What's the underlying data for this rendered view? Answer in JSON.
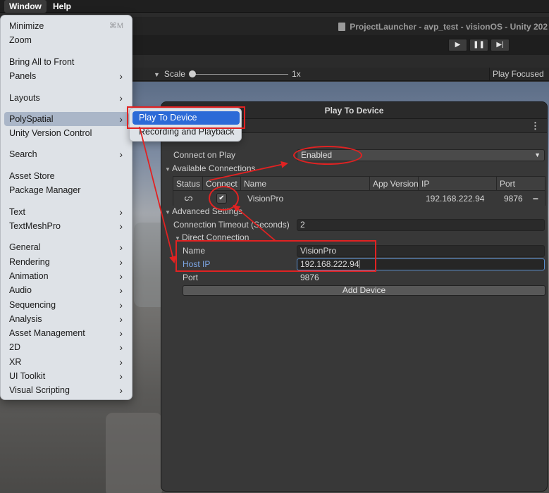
{
  "menubar": {
    "window_label": "Window",
    "help_label": "Help"
  },
  "unity": {
    "window_title": "ProjectLauncher - avp_test - visionOS - Unity 202",
    "scale_label": "Scale",
    "scale_value": "1x",
    "play_focused_label": "Play Focused"
  },
  "window_menu": {
    "items": [
      {
        "label": "Minimize",
        "shortcut": "⌘M"
      },
      {
        "label": "Zoom"
      },
      {
        "label": "Bring All to Front"
      },
      {
        "label": "Panels"
      },
      {
        "label": "Layouts"
      },
      {
        "label": "PolySpatial"
      },
      {
        "label": "Unity Version Control"
      },
      {
        "label": "Search"
      },
      {
        "label": "Asset Store"
      },
      {
        "label": "Package Manager"
      },
      {
        "label": "Text"
      },
      {
        "label": "TextMeshPro"
      },
      {
        "label": "General"
      },
      {
        "label": "Rendering"
      },
      {
        "label": "Animation"
      },
      {
        "label": "Audio"
      },
      {
        "label": "Sequencing"
      },
      {
        "label": "Analysis"
      },
      {
        "label": "Asset Management"
      },
      {
        "label": "2D"
      },
      {
        "label": "XR"
      },
      {
        "label": "UI Toolkit"
      },
      {
        "label": "Visual Scripting"
      }
    ],
    "submenu_arrow": "›"
  },
  "polyspatial_submenu": {
    "items": [
      {
        "label": "Play To Device"
      },
      {
        "label": "Recording and Playback"
      }
    ]
  },
  "play_to_device": {
    "title": "Play To Device",
    "connect_on_play_label": "Connect on Play",
    "connect_on_play_value": "Enabled",
    "available_connections_label": "Available Connections",
    "table": {
      "headers": [
        "Status",
        "Connect",
        "Name",
        "App Version",
        "IP",
        "Port"
      ],
      "row": {
        "connect_check": "✔",
        "name": "VisionPro",
        "app_version": "",
        "ip": "192.168.222.94",
        "port": "9876",
        "remove": "−"
      }
    },
    "advanced_settings_label": "Advanced Settings",
    "connection_timeout_label": "Connection Timeout (Seconds)",
    "connection_timeout_value": "2",
    "direct_connection_label": "Direct Connection",
    "name_label": "Name",
    "name_value": "VisionPro",
    "host_ip_label": "Host IP",
    "host_ip_value": "192.168.222.94",
    "port_label": "Port",
    "port_value": "9876",
    "add_device_label": "Add Device"
  },
  "colors": {
    "annotation_red": "#e12222",
    "selection_blue": "#2c6ad7",
    "menu_bg": "#dee2e7"
  }
}
